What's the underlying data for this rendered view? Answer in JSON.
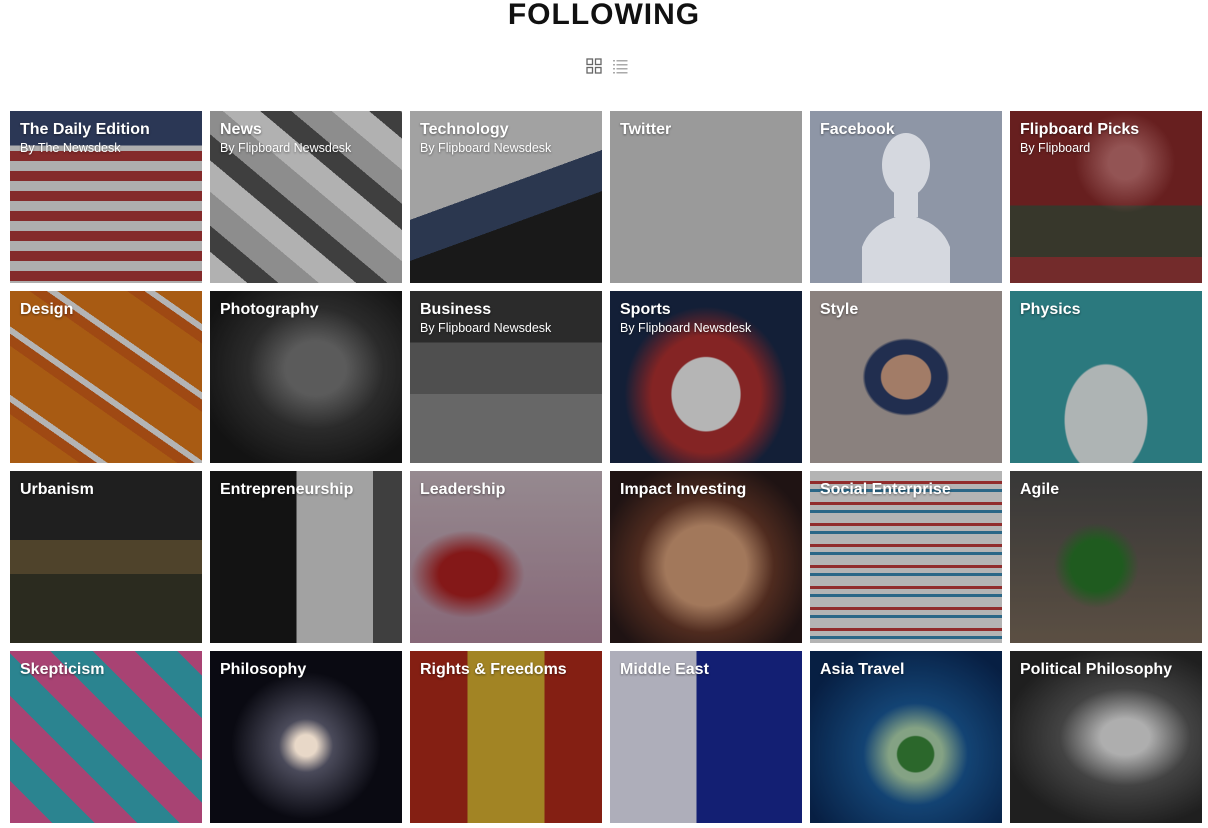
{
  "header": {
    "title": "FOLLOWING"
  },
  "view_toggle": {
    "grid_icon": "grid-view-icon",
    "list_icon": "list-view-icon"
  },
  "tiles": [
    {
      "title": "The Daily Edition",
      "subtitle": "By The Newsdesk"
    },
    {
      "title": "News",
      "subtitle": "By Flipboard Newsdesk"
    },
    {
      "title": "Technology",
      "subtitle": "By Flipboard Newsdesk"
    },
    {
      "title": "Twitter",
      "subtitle": ""
    },
    {
      "title": "Facebook",
      "subtitle": ""
    },
    {
      "title": "Flipboard Picks",
      "subtitle": "By Flipboard"
    },
    {
      "title": "Design",
      "subtitle": ""
    },
    {
      "title": "Photography",
      "subtitle": ""
    },
    {
      "title": "Business",
      "subtitle": "By Flipboard Newsdesk"
    },
    {
      "title": "Sports",
      "subtitle": "By Flipboard Newsdesk"
    },
    {
      "title": "Style",
      "subtitle": ""
    },
    {
      "title": "Physics",
      "subtitle": ""
    },
    {
      "title": "Urbanism",
      "subtitle": ""
    },
    {
      "title": "Entrepreneurship",
      "subtitle": ""
    },
    {
      "title": "Leadership",
      "subtitle": ""
    },
    {
      "title": "Impact Investing",
      "subtitle": ""
    },
    {
      "title": "Social Enterprise",
      "subtitle": ""
    },
    {
      "title": "Agile",
      "subtitle": ""
    },
    {
      "title": "Skepticism",
      "subtitle": ""
    },
    {
      "title": "Philosophy",
      "subtitle": ""
    },
    {
      "title": "Rights & Freedoms",
      "subtitle": ""
    },
    {
      "title": "Middle East",
      "subtitle": ""
    },
    {
      "title": "Asia Travel",
      "subtitle": ""
    },
    {
      "title": "Political Philosophy",
      "subtitle": ""
    }
  ]
}
